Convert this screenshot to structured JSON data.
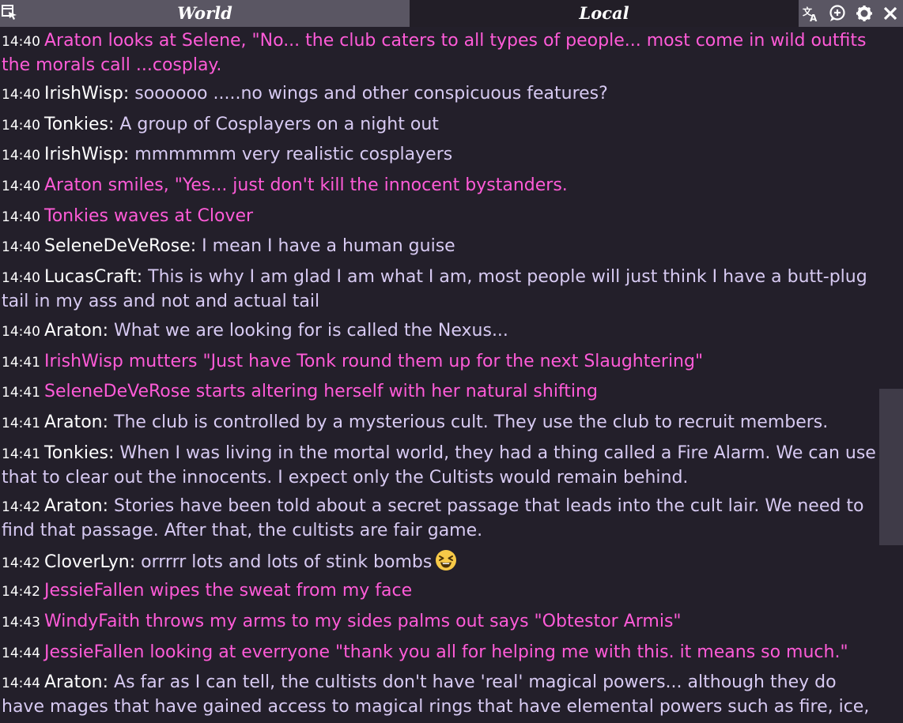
{
  "tabs": [
    {
      "label": "World"
    },
    {
      "label": "Local"
    }
  ],
  "toolbar": {
    "icons": [
      "translate-icon",
      "add-chat-icon",
      "settings-icon",
      "close-icon"
    ]
  },
  "colors": {
    "emote": "#ff5bd8",
    "name": "#ffffff",
    "message": "#d7caf2",
    "active_tab": "#5a5663",
    "background": "#231f2a"
  },
  "messages": [
    {
      "time": "14:40",
      "type": "emote",
      "text": "Araton looks at Selene, \"No... the club caters to all types of people... most come in wild outfits the morals call ...cosplay."
    },
    {
      "time": "14:40",
      "type": "say",
      "name": "IrishWisp:",
      "text": "soooooo .....no wings and other conspicuous features?"
    },
    {
      "time": "14:40",
      "type": "say",
      "name": "Tonkies:",
      "text": "A group of Cosplayers on a night out"
    },
    {
      "time": "14:40",
      "type": "say",
      "name": "IrishWisp:",
      "text": "mmmmmm very realistic cosplayers"
    },
    {
      "time": "14:40",
      "type": "emote",
      "text": "Araton smiles, \"Yes... just don't kill the innocent bystanders."
    },
    {
      "time": "14:40",
      "type": "emote",
      "text": "Tonkies waves at Clover"
    },
    {
      "time": "14:40",
      "type": "say",
      "name": "SeleneDeVeRose:",
      "text": "I mean I have a human guise"
    },
    {
      "time": "14:40",
      "type": "say",
      "name": "LucasCraft:",
      "text": "This is why I am glad I am what I am, most people will just think I have a butt-plug tail in my ass and not and actual tail"
    },
    {
      "time": "14:40",
      "type": "say",
      "name": "Araton:",
      "text": "What we are looking for is called the Nexus..."
    },
    {
      "time": "14:41",
      "type": "emote",
      "text": "IrishWisp mutters \"Just have Tonk round them up for the next Slaughtering\""
    },
    {
      "time": "14:41",
      "type": "emote",
      "text": "SeleneDeVeRose starts altering herself with her natural shifting"
    },
    {
      "time": "14:41",
      "type": "say",
      "name": "Araton:",
      "text": "The club is controlled by a mysterious cult. They use the club to recruit members."
    },
    {
      "time": "14:41",
      "type": "say",
      "name": "Tonkies:",
      "text": "When I was living in the mortal world, they had a thing called a Fire Alarm. We can use that to clear out the innocents. I expect only the Cultists would remain behind."
    },
    {
      "time": "14:42",
      "type": "say",
      "name": "Araton:",
      "text": "Stories have been told about a secret passage that leads into the cult lair. We need to find that passage. After that, the cultists are fair game."
    },
    {
      "time": "14:42",
      "type": "say",
      "name": "CloverLyn:",
      "text": "orrrrr lots and lots of stink bombs",
      "emoji": "laughing-emoji"
    },
    {
      "time": "14:42",
      "type": "emote",
      "text": "JessieFallen wipes the sweat from my face"
    },
    {
      "time": "14:43",
      "type": "emote",
      "text": "WindyFaith throws my arms to my sides palms out says \"Obtestor Armis\""
    },
    {
      "time": "14:44",
      "type": "emote",
      "text": "JessieFallen looking at everryone \"thank you all for helping me with this. it means so much.\""
    },
    {
      "time": "14:44",
      "type": "say",
      "name": "Araton:",
      "text": "As far as I can tell, the cultists don't have 'real' magical powers... although they do have mages that have gained access to magical rings that have elemental powers such as fire, ice,"
    }
  ]
}
